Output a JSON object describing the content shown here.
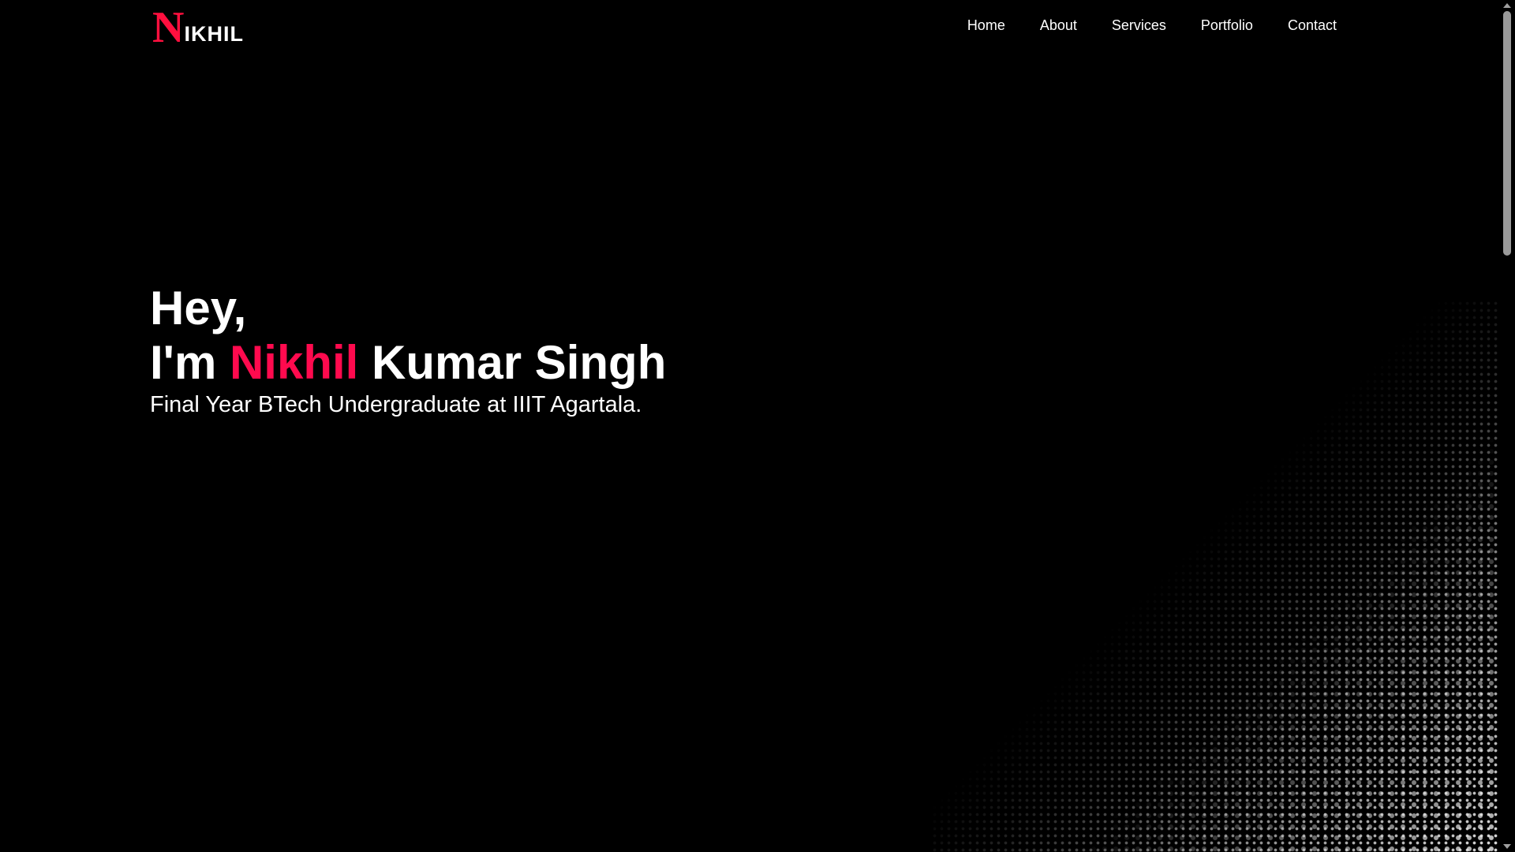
{
  "logo": {
    "initial": "N",
    "rest": "IKHIL",
    "initial_color": "#ff0f3e"
  },
  "nav": {
    "items": [
      {
        "label": "Home"
      },
      {
        "label": "About"
      },
      {
        "label": "Services"
      },
      {
        "label": "Portfolio"
      },
      {
        "label": "Contact"
      }
    ]
  },
  "hero": {
    "greeting": "Hey,",
    "intro_prefix": "I'm ",
    "name_highlight": "Nikhil",
    "name_rest": " Kumar Singh",
    "subtitle": "Final Year BTech Undergraduate at IIIT Agartala.",
    "accent_color": "#ff0a4e"
  },
  "colors": {
    "background": "#000000",
    "text": "#ffffff"
  },
  "icons": {
    "scroll_up": "chevron-up-icon",
    "scroll_down": "chevron-down-icon"
  }
}
